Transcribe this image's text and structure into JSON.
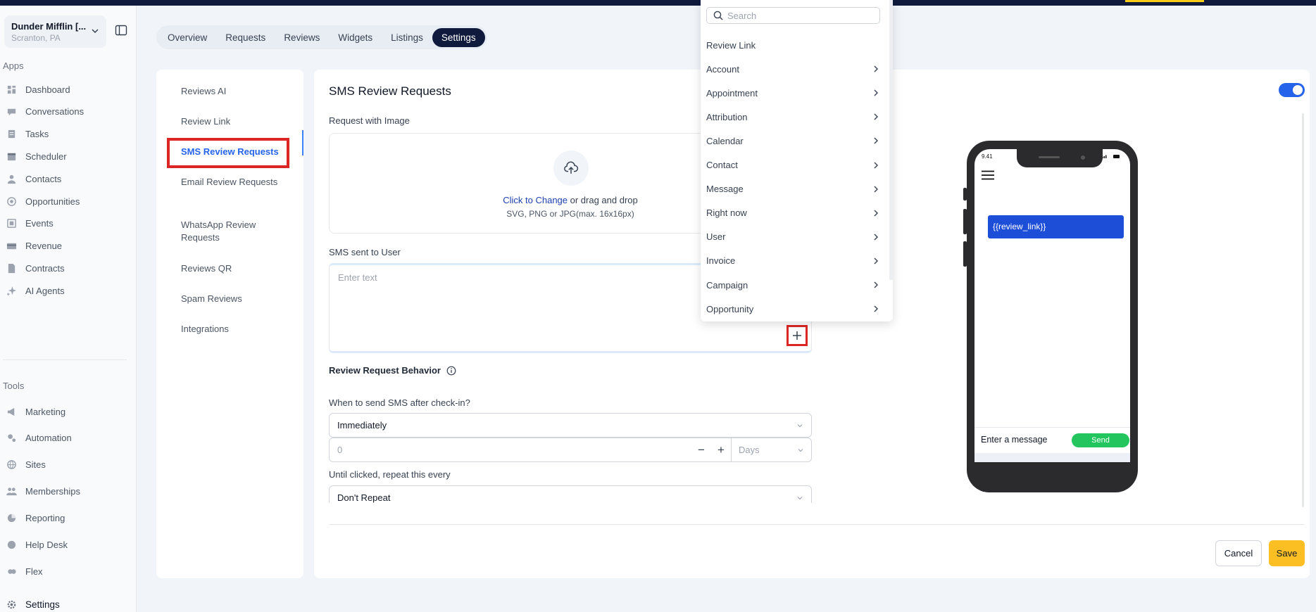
{
  "location": {
    "name": "Dunder Mifflin [...",
    "city": "Scranton, PA"
  },
  "sidebar": {
    "apps_label": "Apps",
    "tools_label": "Tools",
    "apps": [
      {
        "label": "Dashboard",
        "icon": "dashboard-icon"
      },
      {
        "label": "Conversations",
        "icon": "chat-icon"
      },
      {
        "label": "Tasks",
        "icon": "tasks-icon"
      },
      {
        "label": "Scheduler",
        "icon": "calendar-icon"
      },
      {
        "label": "Contacts",
        "icon": "person-icon"
      },
      {
        "label": "Opportunities",
        "icon": "target-icon"
      },
      {
        "label": "Events",
        "icon": "events-icon"
      },
      {
        "label": "Revenue",
        "icon": "card-icon"
      },
      {
        "label": "Contracts",
        "icon": "document-icon"
      },
      {
        "label": "AI Agents",
        "icon": "sparkle-icon"
      }
    ],
    "tools": [
      {
        "label": "Marketing",
        "icon": "megaphone-icon"
      },
      {
        "label": "Automation",
        "icon": "gears-icon"
      },
      {
        "label": "Sites",
        "icon": "globe-icon"
      },
      {
        "label": "Memberships",
        "icon": "group-icon"
      },
      {
        "label": "Reporting",
        "icon": "pie-icon"
      },
      {
        "label": "Help Desk",
        "icon": "help-icon"
      },
      {
        "label": "Flex",
        "icon": "flex-icon"
      }
    ],
    "settings_label": "Settings"
  },
  "tabs": [
    "Overview",
    "Requests",
    "Reviews",
    "Widgets",
    "Listings",
    "Settings"
  ],
  "active_tab": "Settings",
  "subnav": [
    "Reviews AI",
    "Review Link",
    "SMS Review Requests",
    "Email Review Requests",
    "WhatsApp Review Requests",
    "Reviews QR",
    "Spam Reviews",
    "Integrations"
  ],
  "main": {
    "title": "SMS Review Requests",
    "request_image_label": "Request with Image",
    "upload_link": "Click to Change",
    "upload_text": " or drag and drop",
    "upload_formats": "SVG, PNG or JPG(max. 16x16px)",
    "sms_label": "SMS sent to User",
    "sms_placeholder": "Enter text",
    "behavior_label": "Review Request Behavior",
    "when_label": "When to send SMS after check-in?",
    "when_value": "Immediately",
    "delay_value": "0",
    "delay_unit": "Days",
    "repeat_label": "Until clicked, repeat this every",
    "repeat_value": "Don't Repeat",
    "cancel": "Cancel",
    "save": "Save"
  },
  "phone": {
    "time": "9.41",
    "bubble": "{{review_link}}",
    "message_placeholder": "Enter a message",
    "send": "Send"
  },
  "dropdown": {
    "search_placeholder": "Search",
    "items": [
      {
        "label": "Review Link",
        "submenu": false
      },
      {
        "label": "Account",
        "submenu": true
      },
      {
        "label": "Appointment",
        "submenu": true
      },
      {
        "label": "Attribution",
        "submenu": true
      },
      {
        "label": "Calendar",
        "submenu": true
      },
      {
        "label": "Contact",
        "submenu": true
      },
      {
        "label": "Message",
        "submenu": true
      },
      {
        "label": "Right now",
        "submenu": true
      },
      {
        "label": "User",
        "submenu": true
      },
      {
        "label": "Invoice",
        "submenu": true
      },
      {
        "label": "Campaign",
        "submenu": true
      },
      {
        "label": "Opportunity",
        "submenu": true
      }
    ]
  },
  "colors": {
    "accent": "#2563eb",
    "navy": "#0f1a3d",
    "save": "#fbbf24",
    "send": "#22c55e",
    "highlight": "#dc2626"
  }
}
